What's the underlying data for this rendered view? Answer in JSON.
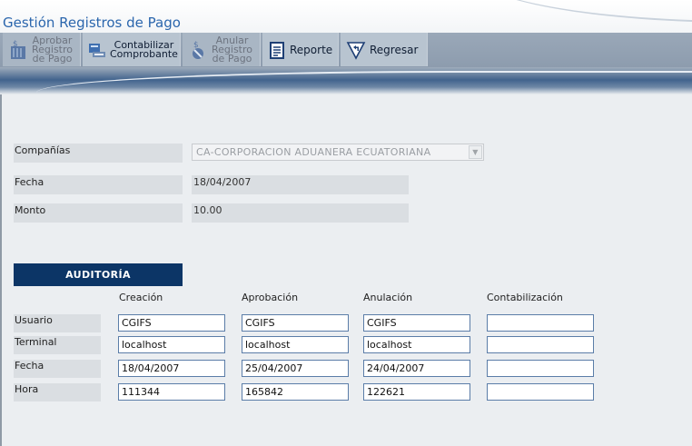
{
  "header": {
    "title": "Gestión Registros de Pago"
  },
  "toolbar": {
    "aprobar": "Aprobar\nRegistro\nde Pago",
    "contabilizar": "Contabilizar\nComprobante",
    "anular": "Anular\nRegistro\nde Pago",
    "reporte": "Reporte",
    "regresar": "Regresar"
  },
  "form": {
    "companias_label": "Compañías",
    "companias_value": "CA-CORPORACION ADUANERA ECUATORIANA",
    "fecha_label": "Fecha",
    "fecha_value": "18/04/2007",
    "monto_label": "Monto",
    "monto_value": "10.00"
  },
  "auditoria": {
    "title": "AUDITORÍA",
    "columns": [
      "Creación",
      "Aprobación",
      "Anulación",
      "Contabilización"
    ],
    "rows": [
      "Usuario",
      "Terminal",
      "Fecha",
      "Hora"
    ],
    "values": {
      "creacion": [
        "CGIFS",
        "localhost",
        "18/04/2007",
        "111344"
      ],
      "aprobacion": [
        "CGIFS",
        "localhost",
        "25/04/2007",
        "165842"
      ],
      "anulacion": [
        "CGIFS",
        "localhost",
        "24/04/2007",
        "122621"
      ],
      "contabilizacion": [
        "",
        "",
        "",
        ""
      ]
    }
  },
  "icons": {
    "aprobar": "approve-payment-icon",
    "contabilizar": "accounting-voucher-icon",
    "anular": "cancel-payment-icon",
    "reporte": "report-icon",
    "regresar": "back-arrow-icon"
  },
  "colors": {
    "title": "#2b66ad",
    "audit_header": "#0c3566",
    "field_border": "#5b7da8"
  }
}
